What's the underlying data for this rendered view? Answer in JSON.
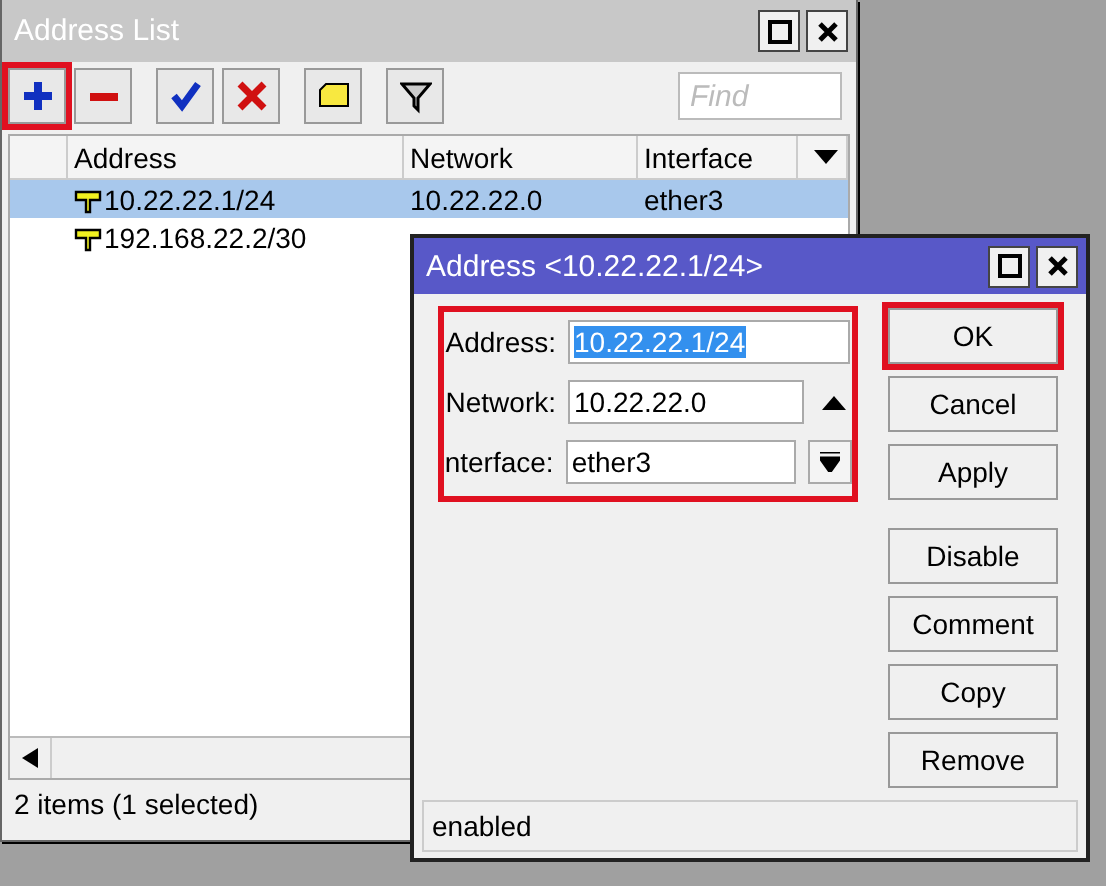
{
  "list_window": {
    "title": "Address List",
    "toolbar": [
      {
        "kind": "add",
        "highlighted": true
      },
      {
        "kind": "remove",
        "highlighted": false
      },
      {
        "kind": "enable",
        "highlighted": false
      },
      {
        "kind": "disable",
        "highlighted": false
      },
      {
        "kind": "comment",
        "highlighted": false
      },
      {
        "kind": "filter",
        "highlighted": false
      }
    ],
    "search": {
      "placeholder": "Find"
    },
    "columns": [
      "Address",
      "Network",
      "Interface"
    ],
    "rows": [
      {
        "address": "10.22.22.1/24",
        "network": "10.22.22.0",
        "interface": "ether3",
        "selected": true
      },
      {
        "address": "192.168.22.2/30",
        "selected": false
      }
    ],
    "status": "2 items (1 selected)"
  },
  "dialog": {
    "title": "Address <10.22.22.1/24>",
    "fields": [
      {
        "label": "Address:",
        "value": "10.22.22.1/24",
        "text_selected": true,
        "kind": "plain"
      },
      {
        "label": "Network:",
        "value": "10.22.22.0",
        "text_selected": false,
        "kind": "up"
      },
      {
        "label": "nterface:",
        "value": "ether3",
        "text_selected": false,
        "kind": "dropdown"
      }
    ],
    "buttons": [
      {
        "label": "OK",
        "highlighted": true
      },
      {
        "label": "Cancel",
        "highlighted": false
      },
      {
        "label": "Apply",
        "highlighted": false
      },
      {
        "label": "Disable",
        "highlighted": false
      },
      {
        "label": "Comment",
        "highlighted": false
      },
      {
        "label": "Copy",
        "highlighted": false
      },
      {
        "label": "Remove",
        "highlighted": false
      }
    ],
    "status": "enabled"
  }
}
